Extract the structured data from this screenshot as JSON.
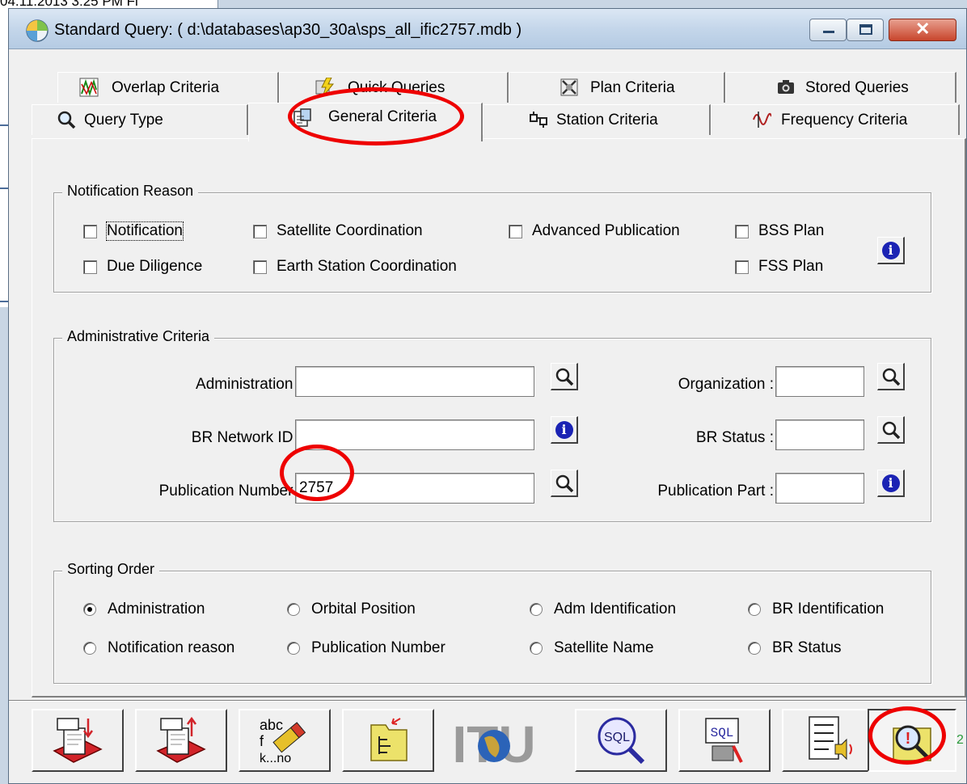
{
  "background": {
    "date_fragment": "04.11.2013 3:25 PM   Fi"
  },
  "window": {
    "title": "Standard Query:  ( d:\\databases\\ap30_30a\\sps_all_ific2757.mdb )",
    "close_glyph": "✕"
  },
  "tabs": {
    "row1": [
      {
        "label": "Overlap Criteria",
        "icon": "overlap-icon"
      },
      {
        "label": "Quick Queries",
        "icon": "lightning-icon"
      },
      {
        "label": "Plan Criteria",
        "icon": "plan-icon"
      },
      {
        "label": "Stored Queries",
        "icon": "camera-icon"
      }
    ],
    "row2": [
      {
        "label": "Query Type",
        "icon": "magnifier-icon"
      },
      {
        "label": "General Criteria",
        "icon": "general-icon",
        "active": true
      },
      {
        "label": "Station Criteria",
        "icon": "station-icon"
      },
      {
        "label": "Frequency Criteria",
        "icon": "frequency-icon"
      }
    ]
  },
  "notification_reason": {
    "legend": "Notification Reason",
    "items": {
      "notification": {
        "label": "Notification",
        "checked": false
      },
      "satellite_coordination": {
        "label": "Satellite Coordination",
        "checked": false
      },
      "advanced_publication": {
        "label": "Advanced Publication",
        "checked": false
      },
      "bss_plan": {
        "label": "BSS Plan",
        "checked": false
      },
      "due_diligence": {
        "label": "Due Diligence",
        "checked": false
      },
      "earth_station_coordination": {
        "label": "Earth Station Coordination",
        "checked": false
      },
      "fss_plan": {
        "label": "FSS Plan",
        "checked": false
      }
    },
    "info_glyph": "i"
  },
  "administrative_criteria": {
    "legend": "Administrative Criteria",
    "administration": {
      "label": "Administration :",
      "value": ""
    },
    "br_network_id": {
      "label": "BR Network ID :",
      "value": ""
    },
    "publication_number": {
      "label": "Publication Number :",
      "value": "2757"
    },
    "organization": {
      "label": "Organization :",
      "value": ""
    },
    "br_status": {
      "label": "BR Status :",
      "value": ""
    },
    "publication_part": {
      "label": "Publication Part :",
      "value": ""
    },
    "info_glyph": "i"
  },
  "sorting_order": {
    "legend": "Sorting Order",
    "selected": "Administration",
    "options": {
      "administration": "Administration",
      "orbital_position": "Orbital Position",
      "adm_identification": "Adm Identification",
      "br_identification": "BR Identification",
      "notification_reason": "Notification reason",
      "publication_number": "Publication Number",
      "satellite_name": "Satellite Name",
      "br_status": "BR Status"
    }
  },
  "toolbar": {
    "sort_text_glyph": "abc\nf\nk...no",
    "sql_label": "SQL",
    "logo_text": "ITU",
    "edge_char": "2"
  },
  "colors": {
    "annotation": "#e00000",
    "info_blue": "#1b23b4",
    "titlebar": "#c4d6ea",
    "close_red": "#c8452c"
  }
}
